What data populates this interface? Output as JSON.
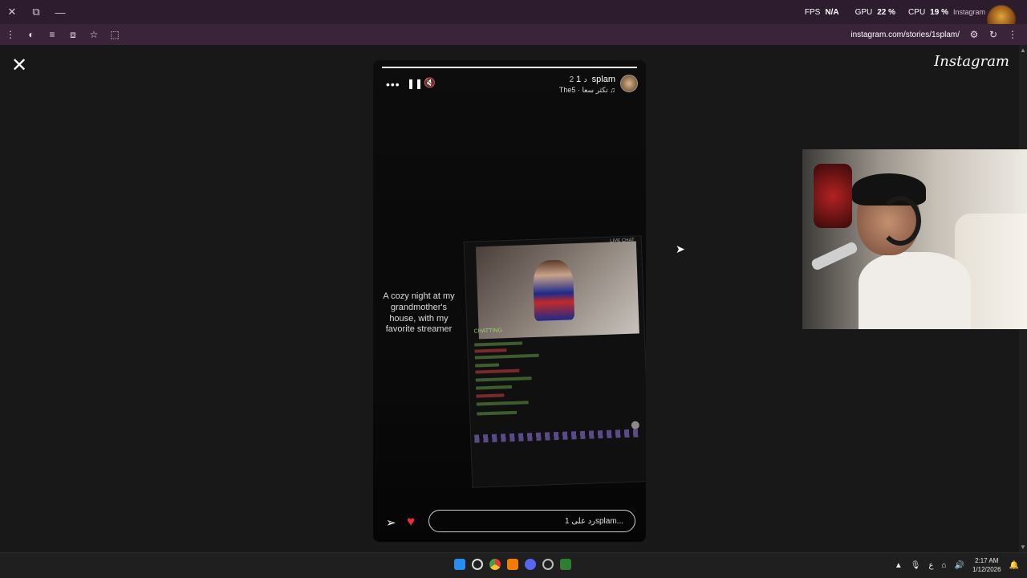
{
  "titlebar": {
    "close": "✕",
    "restore": "⧉",
    "minimize": "—",
    "overlay": {
      "fps_label": "FPS",
      "fps_value": "N/A",
      "gpu_label": "GPU",
      "gpu_value": "22 %",
      "cpu_label": "CPU",
      "cpu_value": "19 %",
      "tab_hint": "Instagram"
    }
  },
  "toolbar": {
    "url": "instagram.com/stories/1splam/"
  },
  "page": {
    "close": "✕",
    "logo": "Instagram"
  },
  "story": {
    "progress": 1.0,
    "more": "•••",
    "pause": "❚❚",
    "mute": "🔇",
    "username": "1splam",
    "time": "2 د",
    "music": "The5 · تكثر سعا ♫",
    "caption": "A cozy night at my grandmother's house, with my favorite streamer",
    "inset": {
      "header": "CHATTING",
      "live": "LIVE CHAT"
    },
    "share": "➢",
    "heart": "♥",
    "reply_placeholder": "رد على 1splam..."
  },
  "taskbar": {
    "tray_lang": "ع",
    "time": "2:17 AM",
    "date": "1/12/2026"
  }
}
